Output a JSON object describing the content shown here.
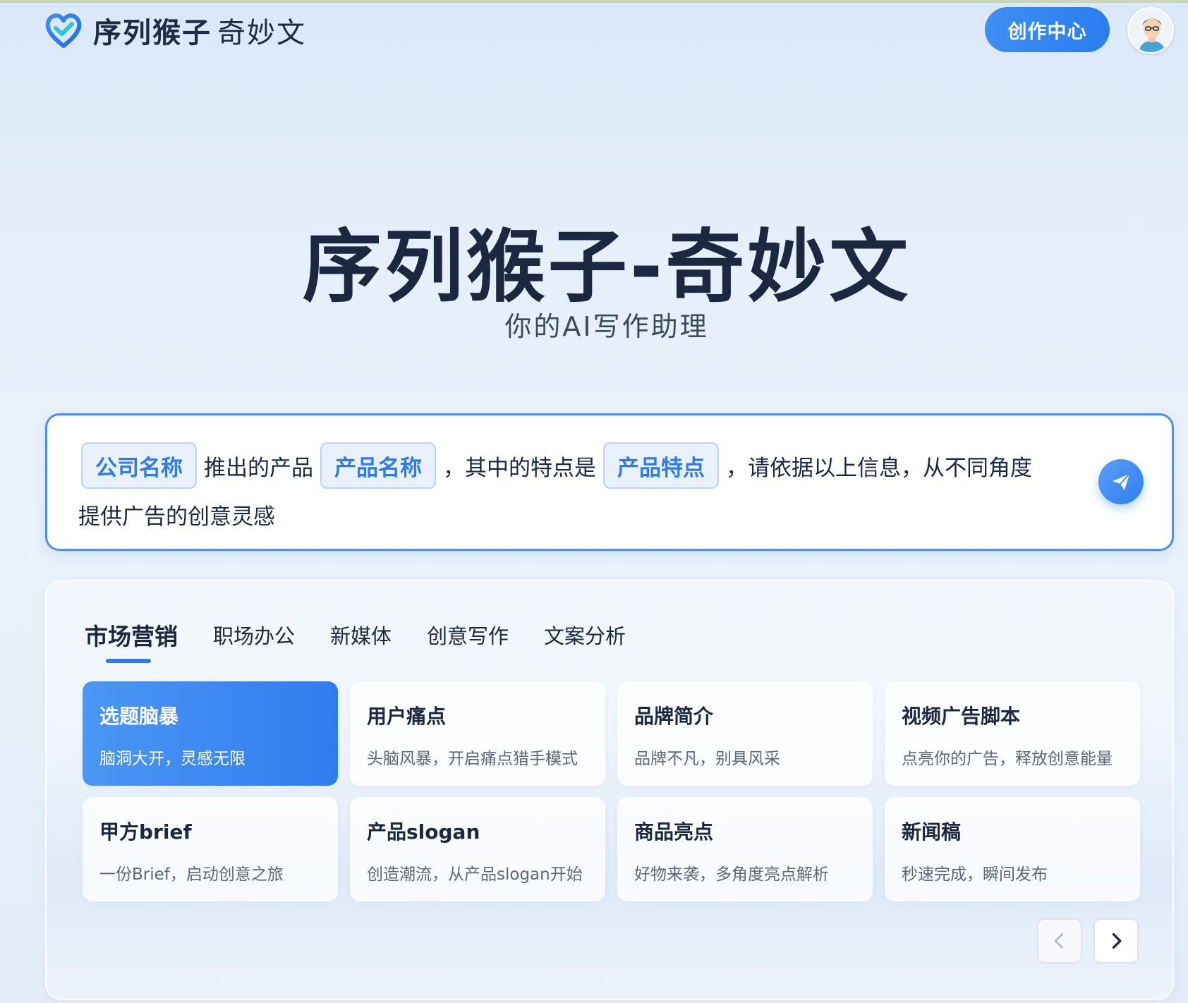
{
  "header": {
    "brand_name": "序列猴子",
    "brand_sub": "奇妙文",
    "create_center_label": "创作中心",
    "logo_icon": "heart-check-logo-icon",
    "avatar_icon": "user-avatar-icon"
  },
  "hero": {
    "title": "序列猴子-奇妙文",
    "subtitle": "你的AI写作助理"
  },
  "prompt": {
    "chip_company": "公司名称",
    "text_1": "推出的产品",
    "chip_product": "产品名称",
    "text_2": "，其中的特点是",
    "chip_feature": "产品特点",
    "text_3": "，请依据以上信息，从不同角度",
    "text_4": "提供广告的创意灵感",
    "send_icon": "paper-plane-icon"
  },
  "tabs": [
    {
      "label": "市场营销"
    },
    {
      "label": "职场办公"
    },
    {
      "label": "新媒体"
    },
    {
      "label": "创意写作"
    },
    {
      "label": "文案分析"
    }
  ],
  "cards": [
    {
      "title": "选题脑暴",
      "desc": "脑洞大开，灵感无限"
    },
    {
      "title": "用户痛点",
      "desc": "头脑风暴，开启痛点猎手模式"
    },
    {
      "title": "品牌简介",
      "desc": "品牌不凡，别具风采"
    },
    {
      "title": "视频广告脚本",
      "desc": "点亮你的广告，释放创意能量"
    },
    {
      "title": "甲方brief",
      "desc": "一份Brief，启动创意之旅"
    },
    {
      "title": "产品slogan",
      "desc": "创造潮流，从产品slogan开始"
    },
    {
      "title": "商品亮点",
      "desc": "好物来袭，多角度亮点解析"
    },
    {
      "title": "新闻稿",
      "desc": "秒速完成，瞬间发布"
    }
  ],
  "pager": {
    "prev_icon": "chevron-left-icon",
    "next_icon": "chevron-right-icon"
  },
  "colors": {
    "accent": "#2f7ce8",
    "brand_dark": "#1c2740"
  }
}
